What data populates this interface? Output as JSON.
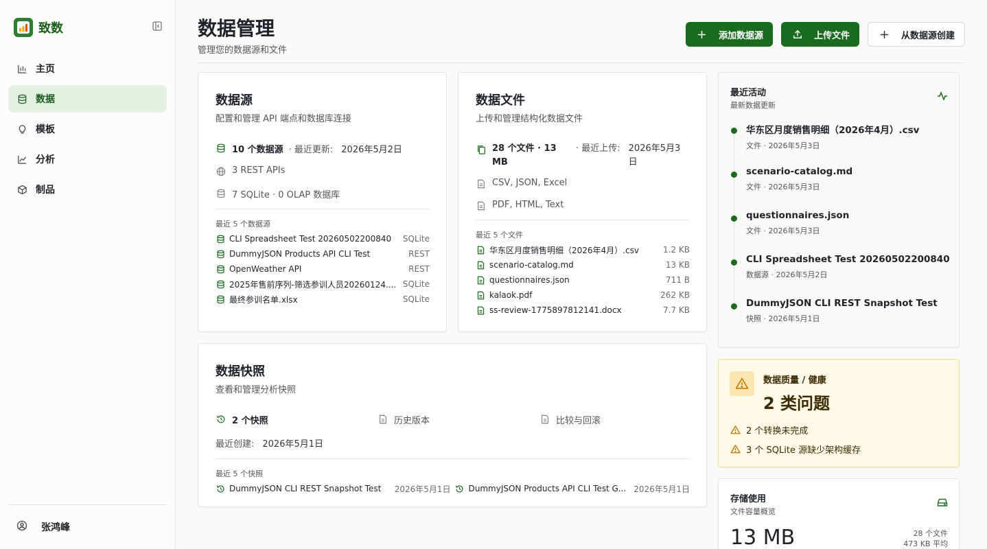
{
  "app": {
    "name": "致数"
  },
  "sidebar": {
    "items": [
      {
        "label": "主页",
        "icon": "bar-chart-icon"
      },
      {
        "label": "数据",
        "icon": "database-icon",
        "active": true
      },
      {
        "label": "模板",
        "icon": "lightbulb-icon"
      },
      {
        "label": "分析",
        "icon": "line-chart-icon"
      },
      {
        "label": "制品",
        "icon": "cube-icon"
      }
    ],
    "user": {
      "name": "张鸿峰"
    }
  },
  "header": {
    "title": "数据管理",
    "subtitle": "管理您的数据源和文件",
    "buttons": {
      "add_source": "添加数据源",
      "upload": "上传文件",
      "create_from_source": "从数据源创建"
    }
  },
  "sources_card": {
    "title": "数据源",
    "subtitle": "配置和管理 API 端点和数据库连接",
    "count": "10 个数据源",
    "updated_label": "· 最近更新:",
    "updated_value": "2026年5月2日",
    "rest": "3 REST APIs",
    "db": "7 SQLite · 0 OLAP 数据库",
    "recent_label": "最近 5 个数据源",
    "recent": [
      {
        "name": "CLI Spreadsheet Test 20260502200840",
        "type": "SQLite"
      },
      {
        "name": "DummyJSON Products API CLI Test",
        "type": "REST"
      },
      {
        "name": "OpenWeather API",
        "type": "REST"
      },
      {
        "name": "2025年售前序列-筛选参训人员20260124....",
        "type": "SQLite"
      },
      {
        "name": "最终参训名单.xlsx",
        "type": "SQLite"
      }
    ]
  },
  "files_card": {
    "title": "数据文件",
    "subtitle": "上传和管理结构化数据文件",
    "count_line1": "28 个文件 · 13",
    "count_line2": "MB",
    "uploaded_label": "· 最近上传:",
    "uploaded_value_1": "2026年5月3",
    "uploaded_value_2": "日",
    "types1": "CSV, JSON, Excel",
    "types2": "PDF, HTML, Text",
    "recent_label": "最近 5 个文件",
    "recent": [
      {
        "name": "华东区月度销售明细（2026年4月）.csv",
        "size": "1.2 KB"
      },
      {
        "name": "scenario-catalog.md",
        "size": "13 KB"
      },
      {
        "name": "questionnaires.json",
        "size": "711 B"
      },
      {
        "name": "kalaok.pdf",
        "size": "262 KB"
      },
      {
        "name": "ss-review-1775897812141.docx",
        "size": "7.7 KB"
      }
    ]
  },
  "snapshots_card": {
    "title": "数据快照",
    "subtitle": "查看和管理分析快照",
    "count": "2 个快照",
    "history": "历史版本",
    "compare": "比较与回滚",
    "created_label": "最近创建:",
    "created_value": "2026年5月1日",
    "recent_label": "最近 5 个快照",
    "recent": [
      {
        "name": "DummyJSON CLI REST Snapshot Test",
        "date": "2026年5月1日"
      },
      {
        "name": "DummyJSON Products API CLI Test G...",
        "date": "2026年5月1日"
      }
    ]
  },
  "activity": {
    "title": "最近活动",
    "subtitle": "最新数据更新",
    "items": [
      {
        "name": "华东区月度销售明细（2026年4月）.csv",
        "meta": "文件 · 2026年5月3日"
      },
      {
        "name": "scenario-catalog.md",
        "meta": "文件 · 2026年5月3日"
      },
      {
        "name": "questionnaires.json",
        "meta": "文件 · 2026年5月3日"
      },
      {
        "name": "CLI Spreadsheet Test 20260502200840",
        "meta": "数据源 · 2026年5月2日"
      },
      {
        "name": "DummyJSON CLI REST Snapshot Test",
        "meta": "快照 · 2026年5月1日"
      }
    ]
  },
  "health": {
    "title": "数据质量 / 健康",
    "headline": "2 类问题",
    "issues": [
      "2 个转换未完成",
      "3 个 SQLite 源缺少架构缓存"
    ]
  },
  "storage": {
    "title": "存储使用",
    "subtitle": "文件容量概览",
    "total": "13 MB",
    "files": "28 个文件",
    "avg": "473 KB 平均"
  },
  "colors": {
    "accent": "#1a6b1f",
    "active_bg": "#e3f0e3",
    "warning": "#c77800"
  }
}
